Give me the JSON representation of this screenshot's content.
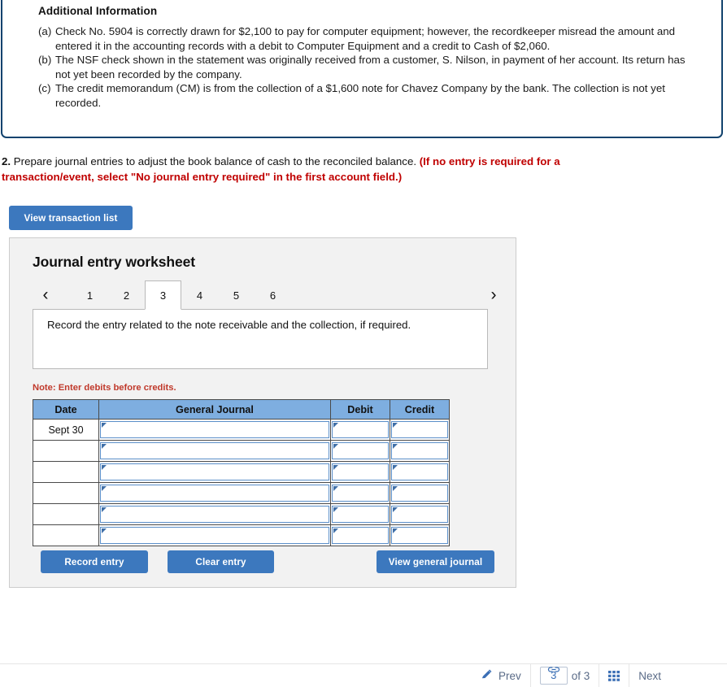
{
  "info_panel": {
    "title": "Additional Information",
    "items": [
      {
        "marker": "(a)",
        "text": "Check No. 5904 is correctly drawn for $2,100 to pay for computer equipment; however, the recordkeeper misread the amount and entered it in the accounting records with a debit to Computer Equipment and a credit to Cash of $2,060."
      },
      {
        "marker": "(b)",
        "text": "The NSF check shown in the statement was originally received from a customer, S. Nilson, in payment of her account. Its return has not yet been recorded by the company."
      },
      {
        "marker": "(c)",
        "text": "The credit memorandum (CM) is from the collection of a $1,600 note for Chavez Company by the bank. The collection is not yet recorded."
      }
    ]
  },
  "requirement": {
    "number": "2.",
    "text": " Prepare journal entries to adjust the book balance of cash to the reconciled balance. ",
    "emphasis": "(If no entry is required for a transaction/event, select \"No journal entry required\" in the first account field.)"
  },
  "view_transaction_list_label": "View transaction list",
  "worksheet": {
    "title": "Journal entry worksheet",
    "prev_arrow": "‹",
    "next_arrow": "›",
    "tabs": [
      "1",
      "2",
      "3",
      "4",
      "5",
      "6"
    ],
    "active_tab": "3",
    "instruction": "Record the entry related to the note receivable and the collection, if required.",
    "note": "Note: Enter debits before credits.",
    "table": {
      "headers": [
        "Date",
        "General Journal",
        "Debit",
        "Credit"
      ],
      "rows": [
        {
          "date": "Sept 30",
          "general_journal": "",
          "debit": "",
          "credit": ""
        },
        {
          "date": "",
          "general_journal": "",
          "debit": "",
          "credit": ""
        },
        {
          "date": "",
          "general_journal": "",
          "debit": "",
          "credit": ""
        },
        {
          "date": "",
          "general_journal": "",
          "debit": "",
          "credit": ""
        },
        {
          "date": "",
          "general_journal": "",
          "debit": "",
          "credit": ""
        },
        {
          "date": "",
          "general_journal": "",
          "debit": "",
          "credit": ""
        }
      ]
    },
    "record_entry_label": "Record entry",
    "clear_entry_label": "Clear entry",
    "view_general_journal_label": "View general journal"
  },
  "footer": {
    "prev_label": "Prev",
    "page_value": "3",
    "page_of": "of 3",
    "next_label": "Next"
  },
  "colors": {
    "panel_border": "#12436e",
    "button_blue": "#3c78be",
    "table_header_blue": "#7eaee0",
    "input_border_blue": "#5b8fc9",
    "note_red": "#c0392b",
    "emphasis_red": "#c00000",
    "worksheet_bg": "#f2f2f2",
    "footer_text": "#5a6b87"
  }
}
